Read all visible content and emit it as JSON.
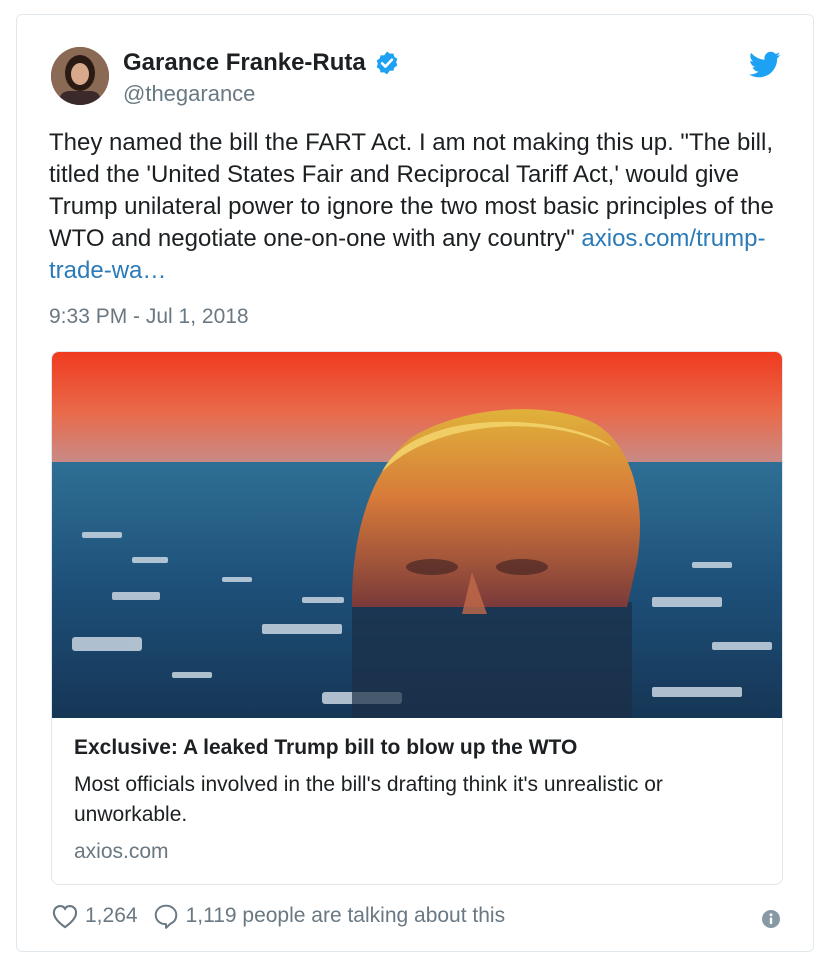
{
  "author": {
    "name": "Garance Franke-Ruta",
    "handle": "@thegarance"
  },
  "tweet": {
    "text": "They named the bill the FART Act. I am not making this up. \"The bill, titled the 'United States Fair and Reciprocal Tariff Act,' would give Trump unilateral power to ignore the two most basic principles of the WTO and negotiate one-on-one with any country\" ",
    "link": "axios.com/trump-trade-wa…",
    "timestamp": "9:33 PM - Jul 1, 2018"
  },
  "card": {
    "title": "Exclusive: A leaked Trump bill to blow up the WTO",
    "description": "Most officials involved in the bill's drafting think it's unrealistic or unworkable.",
    "domain": "axios.com"
  },
  "actions": {
    "likes": "1,264",
    "talking": "1,119 people are talking about this"
  },
  "colors": {
    "link": "#2b7bb9",
    "twitter_blue": "#1da1f2",
    "muted": "#697882"
  },
  "icons": {
    "verified": "verified-badge-icon",
    "bird": "twitter-bird-icon",
    "like": "heart-icon",
    "reply": "speech-bubble-icon",
    "info": "info-icon"
  }
}
